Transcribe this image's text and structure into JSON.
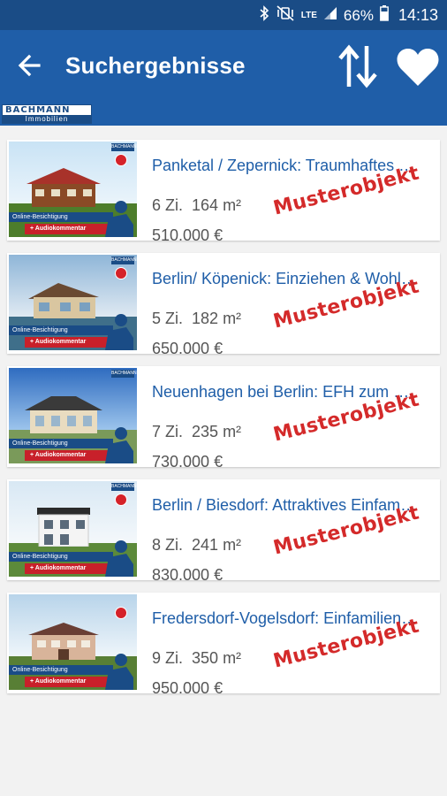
{
  "status": {
    "battery": "66%",
    "time": "14:13",
    "network": "LTE"
  },
  "header": {
    "title": "Suchergebnisse"
  },
  "brand": {
    "line1": "BACHMANN",
    "line2": "Immobilien"
  },
  "thumb_labels": {
    "tag": "BACHMANN",
    "online": "Online-Besichtigung",
    "audio": "+ Audiokommentar"
  },
  "listings": [
    {
      "title": "Panketal / Zepernick: Traumhaftes …",
      "rooms": "6 Zi.",
      "area": "164 m²",
      "price": "510.000 €",
      "watermark": "Musterobjekt"
    },
    {
      "title": "Berlin/ Köpenick: Einziehen & Wohl…",
      "rooms": "5 Zi.",
      "area": "182 m²",
      "price": "650.000 €",
      "watermark": "Musterobjekt"
    },
    {
      "title": "Neuenhagen bei Berlin:  EFH zum …",
      "rooms": "7 Zi.",
      "area": "235 m²",
      "price": "730.000 €",
      "watermark": "Musterobjekt"
    },
    {
      "title": "Berlin / Biesdorf: Attraktives Einfam…",
      "rooms": "8 Zi.",
      "area": "241 m²",
      "price": "830.000 €",
      "watermark": "Musterobjekt"
    },
    {
      "title": "Fredersdorf-Vogelsdorf: Einfamilien…",
      "rooms": "9 Zi.",
      "area": "350 m²",
      "price": "950.000 €",
      "watermark": "Musterobjekt"
    }
  ],
  "colors": {
    "primary": "#1f5ea8",
    "statusbar": "#1a4c86",
    "watermark": "#d42a2a",
    "background": "#f2f2f2"
  },
  "icons": {
    "back": "arrow-back-icon",
    "sort": "sort-arrows-icon",
    "favorite": "heart-icon"
  }
}
